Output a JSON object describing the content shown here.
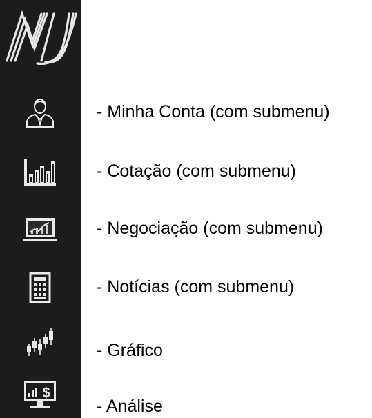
{
  "sidebar": {
    "logo_icon": "nj-logo-icon",
    "background_color": "#1c1c1c",
    "icon_color": "#e9e9e9"
  },
  "menu": [
    {
      "icon": "user-account-icon",
      "label": "- Minha Conta (com submenu)"
    },
    {
      "icon": "bar-chart-icon",
      "label": "- Cotação (com submenu)"
    },
    {
      "icon": "trading-screen-icon",
      "label": "- Negociação (com submenu)"
    },
    {
      "icon": "news-document-icon",
      "label": "- Notícias (com submenu)"
    },
    {
      "icon": "candlestick-chart-icon",
      "label": "- Gráfico"
    },
    {
      "icon": "monitor-dollar-icon",
      "label": "- Análise"
    }
  ]
}
